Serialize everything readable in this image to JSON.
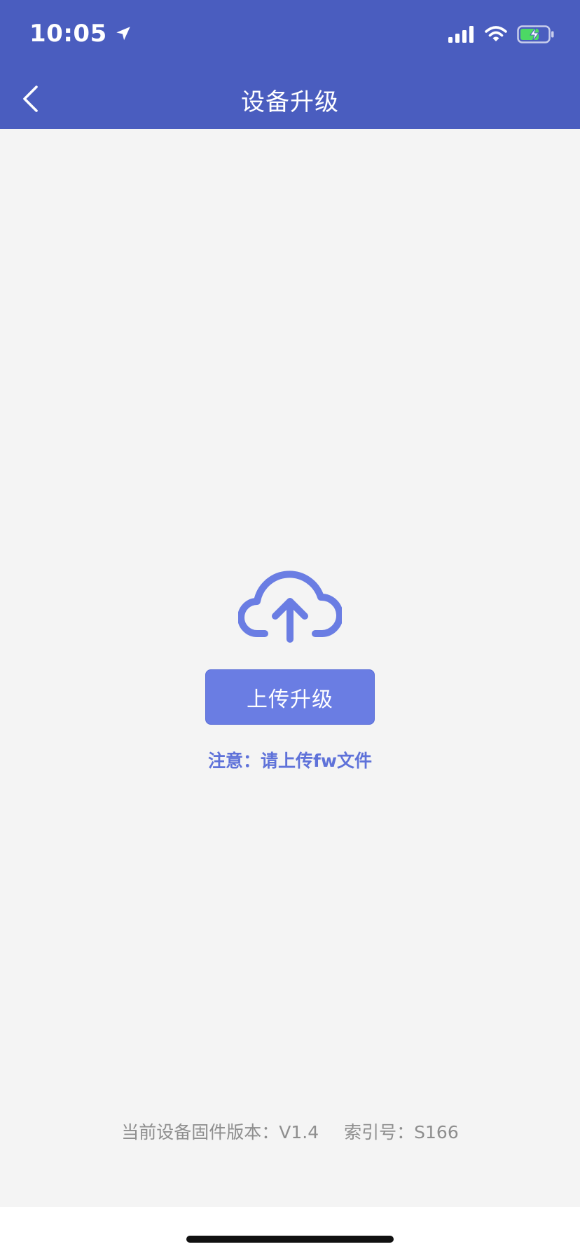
{
  "status_bar": {
    "time": "10:05"
  },
  "header": {
    "title": "设备升级"
  },
  "main": {
    "upload_button_label": "上传升级",
    "note": "注意：请上传fw文件"
  },
  "footer": {
    "firmware_version": "当前设备固件版本：V1.4",
    "index_number": "索引号：S166"
  },
  "colors": {
    "header_bg": "#4a5dbf",
    "accent": "#6a7de3",
    "page_bg": "#f4f4f4",
    "footer_text": "#8e8e8e"
  },
  "icons": {
    "back": "chevron-left-icon",
    "location": "location-arrow-icon",
    "signal": "cellular-signal-icon",
    "wifi": "wifi-icon",
    "battery": "battery-charging-icon",
    "upload": "cloud-upload-icon"
  }
}
